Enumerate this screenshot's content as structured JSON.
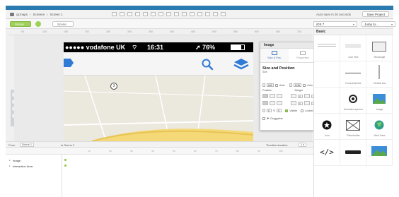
{
  "breadcrumb": [
    "q1maps",
    "Screens",
    "Screen 1"
  ],
  "toolbar": {
    "save_status": "Auto save in 30 seconds",
    "save_label": "Save Project"
  },
  "scenes": {
    "active": "Scene 2",
    "other": "Scene 3"
  },
  "device_select": "iOS 7",
  "jump_select": "Jump to...",
  "ruler_ticks": [
    "50",
    "100",
    "150",
    "200",
    "250",
    "300",
    "350",
    "400",
    "450",
    "500",
    "550",
    "600",
    "650",
    "700"
  ],
  "phone": {
    "carrier": "●●●●● vodafone UK",
    "time": "16:31",
    "battery": "76%"
  },
  "image_panel": {
    "title": "Image",
    "tabs": [
      "Size & Pos.",
      "Properties",
      "Interactions"
    ],
    "section_title": "Size and Position",
    "size_label": "Size",
    "width": "640",
    "width_auto": "Auto",
    "height": "1136",
    "height_auto": "Auto",
    "position_label": "Position",
    "margin_label": "Margin",
    "margin_values": [
      "0",
      "0",
      "0",
      "0"
    ],
    "x_value": "0",
    "rotation": "0",
    "visible_label": "Visible",
    "locked_label": "Locked",
    "draggable_label": "Draggable"
  },
  "basic_panel": {
    "title": "Basic",
    "widgets": [
      "",
      "Icon Text",
      "Rectangle",
      "",
      "Horizontal line",
      "Vertical line",
      "",
      "Animated spinner",
      "Image",
      "Icon",
      "Placeholder",
      "Web View",
      "",
      "",
      ""
    ]
  },
  "timeline": {
    "from_label": "From",
    "from_value": "Scene 1",
    "to_label": "to Scene 2",
    "duration_label": "Timeline duration",
    "duration_value": "1 s",
    "ticks": [
      "1s",
      "2s",
      "3s",
      "4s",
      "5s",
      "6s",
      "7s",
      "8s",
      "9s",
      "10s"
    ]
  },
  "layers": [
    "Image",
    "Interaction Area"
  ],
  "colors": {
    "accent_green": "#9fd05a",
    "top_blue": "#2b7bb0",
    "ios_blue": "#2f7bd6"
  }
}
